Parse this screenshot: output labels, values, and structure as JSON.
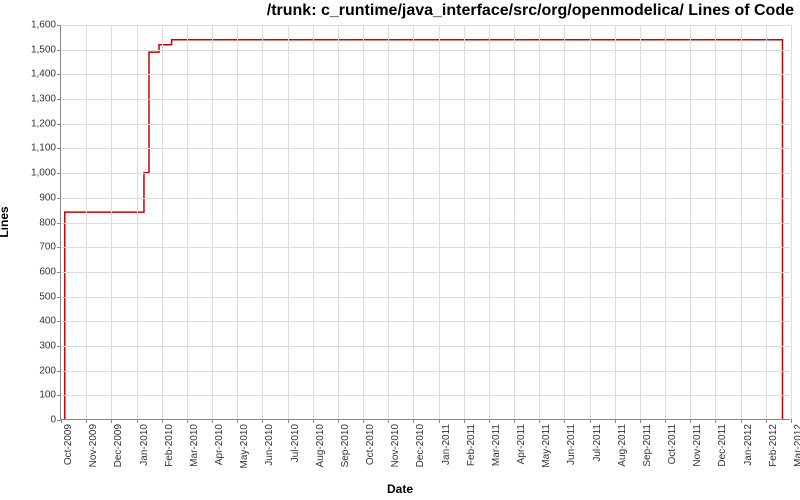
{
  "chart_data": {
    "type": "line",
    "title": "/trunk: c_runtime/java_interface/src/org/openmodelica/ Lines of Code",
    "xlabel": "Date",
    "ylabel": "Lines",
    "ylim": [
      0,
      1600
    ],
    "y_ticks": [
      0,
      100,
      200,
      300,
      400,
      500,
      600,
      700,
      800,
      900,
      1000,
      1100,
      1200,
      1300,
      1400,
      1500,
      1600
    ],
    "y_tick_labels": [
      "0",
      "100",
      "200",
      "300",
      "400",
      "500",
      "600",
      "700",
      "800",
      "900",
      "1,000",
      "1,100",
      "1,200",
      "1,300",
      "1,400",
      "1,500",
      "1,600"
    ],
    "x_categories": [
      "Oct-2009",
      "Nov-2009",
      "Dec-2009",
      "Jan-2010",
      "Feb-2010",
      "Mar-2010",
      "Apr-2010",
      "May-2010",
      "Jun-2010",
      "Jul-2010",
      "Aug-2010",
      "Sep-2010",
      "Oct-2010",
      "Nov-2010",
      "Dec-2010",
      "Jan-2011",
      "Feb-2011",
      "Mar-2011",
      "Apr-2011",
      "May-2011",
      "Jun-2011",
      "Jul-2011",
      "Aug-2011",
      "Sep-2011",
      "Oct-2011",
      "Nov-2011",
      "Dec-2011",
      "Jan-2012",
      "Feb-2012",
      "Mar-2012"
    ],
    "series": [
      {
        "name": "Lines of Code",
        "color": "#cc0000",
        "points": [
          {
            "xi": 0.15,
            "y": 0
          },
          {
            "xi": 0.15,
            "y": 840
          },
          {
            "xi": 3.3,
            "y": 840
          },
          {
            "xi": 3.3,
            "y": 1000
          },
          {
            "xi": 3.5,
            "y": 1000
          },
          {
            "xi": 3.5,
            "y": 1490
          },
          {
            "xi": 3.9,
            "y": 1490
          },
          {
            "xi": 3.9,
            "y": 1520
          },
          {
            "xi": 4.4,
            "y": 1520
          },
          {
            "xi": 4.4,
            "y": 1540
          },
          {
            "xi": 28.7,
            "y": 1540
          },
          {
            "xi": 28.7,
            "y": 0
          }
        ]
      }
    ]
  }
}
